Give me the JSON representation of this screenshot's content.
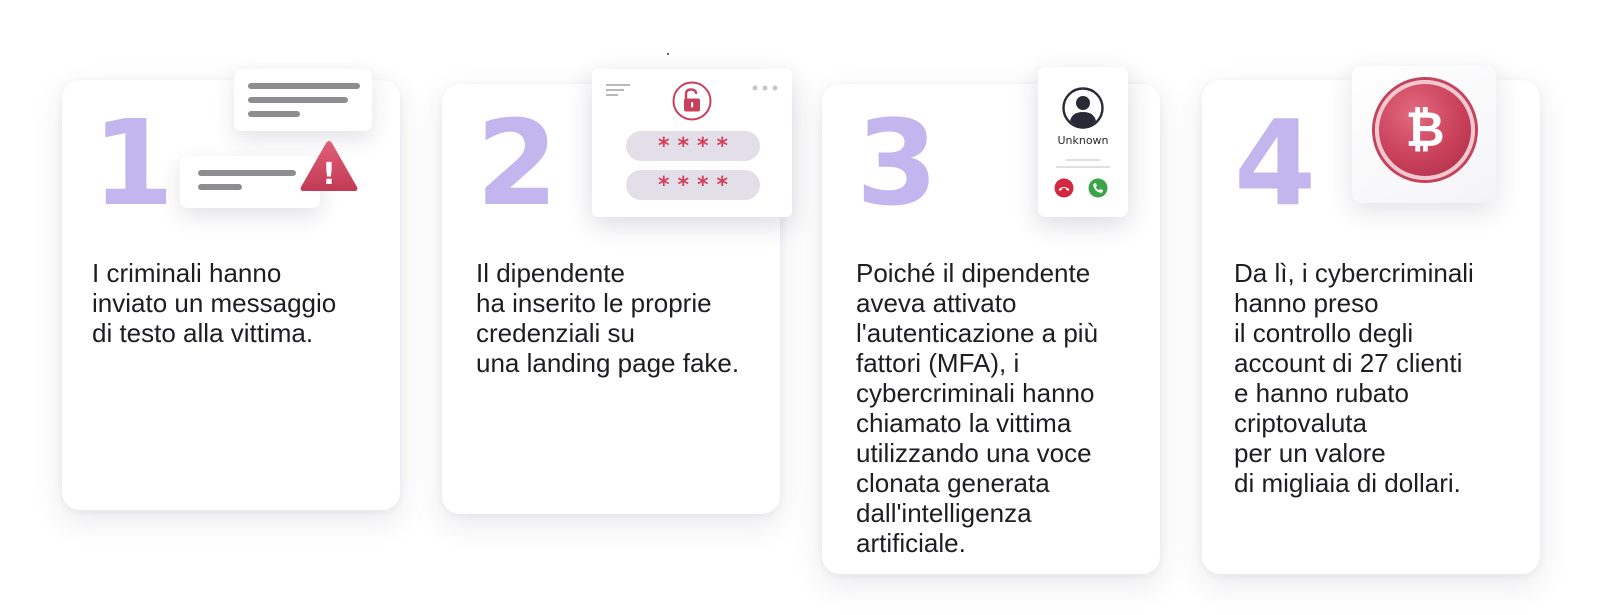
{
  "steps": [
    {
      "number": "1",
      "text": "I criminali hanno\ninviato un messaggio\ndi testo alla vittima.",
      "graphic": {
        "icons": [
          "chat-bubble-icon",
          "warning-icon"
        ],
        "warning_symbol": "!"
      }
    },
    {
      "number": "2",
      "text": "Il dipendente\nha inserito le proprie\ncredenziali su\nuna landing page fake.",
      "graphic": {
        "icons": [
          "menu-icon",
          "unlocked-padlock-icon",
          "more-dots-icon"
        ],
        "password_masks": [
          "****",
          "****"
        ]
      }
    },
    {
      "number": "3",
      "text": "Poiché il dipendente\naveva attivato\nl'autenticazione a più\nfattori (MFA), i\ncybercriminali hanno\nchiamato la vittima\nutilizzando una voce\nclonata generata\ndall'intelligenza\nartificiale.",
      "graphic": {
        "icons": [
          "sound-wave-icon",
          "user-avatar-icon",
          "decline-call-icon",
          "accept-call-icon"
        ],
        "caller": "Unknown"
      }
    },
    {
      "number": "4",
      "text": "Da lì, i cybercriminali\nhanno preso\nil controllo degli\naccount di 27 clienti\ne hanno rubato\ncriptovaluta\nper un valore\ndi migliaia di dollari.",
      "graphic": {
        "icons": [
          "bitcoin-icon"
        ],
        "symbol": "₿"
      }
    }
  ],
  "colors": {
    "number": "#c3b6ef",
    "accent": "#c9405a",
    "text": "#1d1d22",
    "accept": "#3aa447",
    "decline": "#d3283f"
  }
}
